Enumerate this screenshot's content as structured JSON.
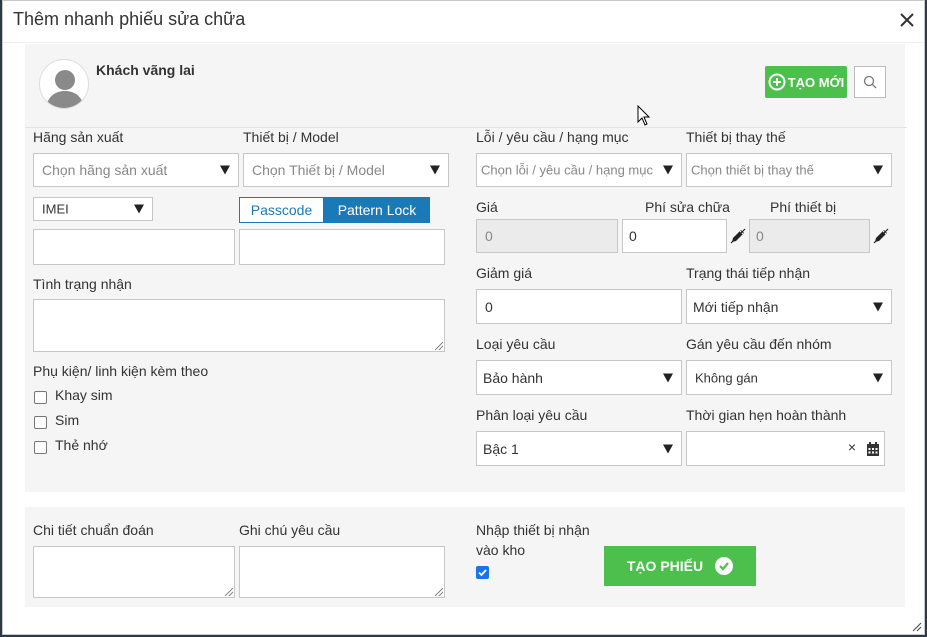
{
  "dialog": {
    "title": "Thêm nhanh phiếu sửa chữa"
  },
  "customer": {
    "name": "Khách vãng lai",
    "create_label": "TẠO MỚI"
  },
  "left": {
    "manufacturer_label": "Hãng sản xuất",
    "manufacturer_placeholder": "Chọn hãng sản xuất",
    "device_label": "Thiết bị / Model",
    "device_placeholder": "Chọn Thiết bị / Model",
    "imei_option": "IMEI",
    "imei_value": "",
    "passcode_tab": "Passcode",
    "pattern_tab": "Pattern Lock",
    "lock_value": "",
    "condition_label": "Tình trạng nhận",
    "accessories_label": "Phụ kiện/ linh kiện kèm theo",
    "accessories": [
      {
        "label": "Khay sim",
        "checked": false
      },
      {
        "label": "Sim",
        "checked": false
      },
      {
        "label": "Thẻ nhớ",
        "checked": false
      }
    ]
  },
  "right": {
    "issue_label": "Lỗi / yêu cầu / hạng mục",
    "issue_placeholder": "Chọn lỗi / yêu cầu / hạng mục",
    "replacement_label": "Thiết bị thay thế",
    "replacement_placeholder": "Chọn thiết bị thay thế",
    "price_label": "Giá",
    "price_value": "0",
    "repair_fee_label": "Phí sửa chữa",
    "repair_fee_value": "0",
    "device_fee_label": "Phí thiết bị",
    "device_fee_value": "0",
    "discount_label": "Giảm giá",
    "discount_value": "0",
    "status_label": "Trạng thái tiếp nhận",
    "status_value": "Mới tiếp nhận",
    "request_type_label": "Loại yêu cầu",
    "request_type_value": "Bảo hành",
    "assign_group_label": "Gán yêu cầu đến nhóm",
    "assign_group_value": "Không gán",
    "classification_label": "Phân loại yêu cầu",
    "classification_value": "Bậc 1",
    "due_time_label": "Thời gian hẹn hoàn thành",
    "due_time_value": "",
    "due_clear": "×"
  },
  "bottom": {
    "diagnosis_label": "Chi tiết chuẩn đoán",
    "note_label": "Ghi chú yêu cầu",
    "stock_label_line1": "Nhập thiết bị nhận",
    "stock_label_line2": "vào kho",
    "stock_checked": true,
    "create_ticket_label": "TẠO PHIẾU"
  },
  "colors": {
    "accent_green": "#4cbf4c",
    "tab_active": "#1a7ab8",
    "checkbox_blue": "#1a73e8"
  },
  "icons": [
    "close-icon",
    "avatar-icon",
    "plus-circle-icon",
    "search-icon",
    "edit-icon",
    "calendar-icon",
    "check-circle-icon"
  ]
}
